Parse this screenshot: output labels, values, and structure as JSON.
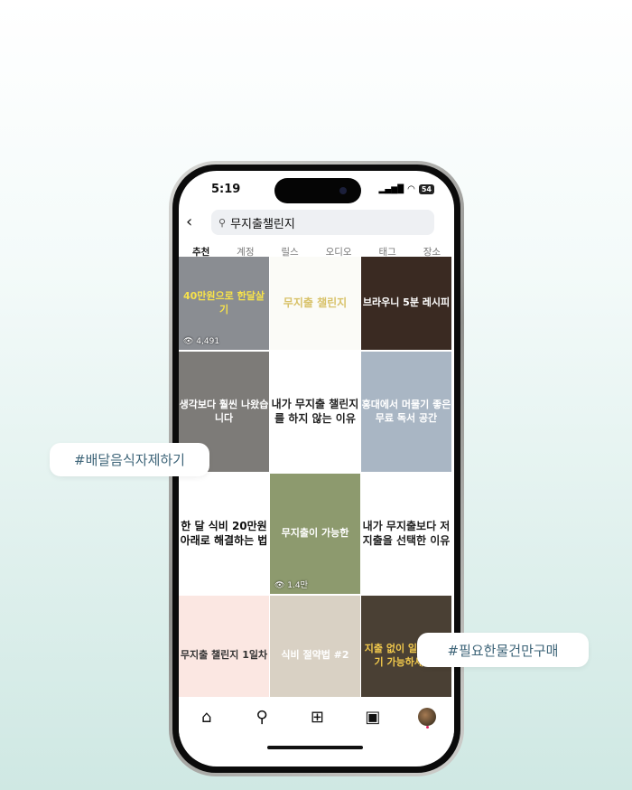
{
  "status": {
    "time": "5:19",
    "battery": "54"
  },
  "search": {
    "query": "무지출챌린지"
  },
  "tabs": [
    "추천",
    "계정",
    "릴스",
    "오디오",
    "태그",
    "장소"
  ],
  "grid": [
    {
      "text": "40만원으로 한달살기",
      "views": "4,491",
      "bg": "#8a8d92",
      "color": "#f7e24a"
    },
    {
      "text": "무지출 챌린지",
      "bg": "#fbfbf7",
      "color": "#d8c26a"
    },
    {
      "text": "브라우니 5분 레시피",
      "bg": "#3a2a22",
      "color": "#fff"
    },
    {
      "text": "생각보다 훨씬 나왔습니다",
      "bg": "#7d7b78",
      "color": "#fff"
    },
    {
      "text": "내가 무지출 챌린지를 하지 않는 이유",
      "bg": "#ffffff",
      "color": "#222"
    },
    {
      "text": "홍대에서 머물기 좋은 무료 독서 공간",
      "bg": "#a9b6c4",
      "color": "#fff"
    },
    {
      "text": "한 달 식비 20만원 아래로 해결하는 법",
      "bg": "#ffffff",
      "color": "#111"
    },
    {
      "text": "무지출이 가능한",
      "views": "1.4만",
      "bg": "#8d9a6e",
      "color": "#fff"
    },
    {
      "text": "내가 무지출보다 저지출을 선택한 이유",
      "bg": "#ffffff",
      "color": "#222"
    },
    {
      "text": "무지출 챌린지 1일차",
      "bg": "#fbe7e2",
      "color": "#333"
    },
    {
      "text": "식비 절약법 #2",
      "bg": "#d9d1c4",
      "color": "#fff"
    },
    {
      "text": "지출 없이 일주일 살기 가능하세요?",
      "bg": "#4a4034",
      "color": "#f2c94c"
    }
  ],
  "pills": {
    "left": "#배달음식자제하기",
    "right": "#필요한물건만구매"
  }
}
